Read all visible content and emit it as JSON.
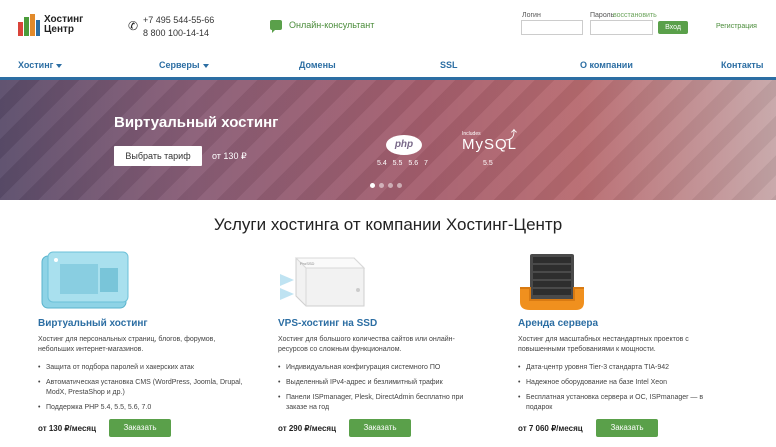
{
  "header": {
    "logo_text_line1": "Хостинг",
    "logo_text_line2": "Центр",
    "phone1": "+7 495 544-55-66",
    "phone2": "8 800 100-14-14",
    "consult_label": "Онлайн-консультант",
    "login_label": "Логин",
    "password_label": "Пароль",
    "forgot_label": "восстановить",
    "login_button": "Вход",
    "register_link": "Регистрация"
  },
  "nav": {
    "items": [
      {
        "label": "Хостинг"
      },
      {
        "label": "Серверы"
      },
      {
        "label": "Домены"
      },
      {
        "label": "SSL"
      },
      {
        "label": "О компании"
      },
      {
        "label": "Контакты"
      }
    ]
  },
  "banner": {
    "title": "Виртуальный хостинг",
    "button": "Выбрать тариф",
    "price": "от 130 ₽",
    "php_logo": "php",
    "php_versions": "5.4 5.5 5.6 7",
    "mysql_includes": "Includes",
    "mysql_logo": "MySQL",
    "mysql_version": "5.5",
    "slide_count": 4,
    "active_slide": 1
  },
  "section": {
    "title": "Услуги хостинга от компании Хостинг-Центр"
  },
  "services": [
    {
      "title": "Виртуальный хостинг",
      "desc": "Хостинг для персональных страниц, блогов, форумов, небольших интернет-магазинов.",
      "features": [
        "Защита от подбора паролей и хакерских атак",
        "Автоматическая установка CMS (WordPress, Joomla, Drupal, ModX, PrestaShop и др.)",
        "Поддержка PHP 5.4, 5.5, 5.6, 7.0"
      ],
      "price": "от 130 ₽/месяц",
      "button": "Заказать"
    },
    {
      "title": "VPS-хостинг на SSD",
      "desc": "Хостинг для большого количества сайтов или онлайн-ресурсов со сложным функционалом.",
      "features": [
        "Индивидуальная конфигурация системного ПО",
        "Выделенный IPv4-адрес и безлимитный трафик",
        "Панели ISPmanager, Plesk, DirectAdmin бесплатно при заказе на год"
      ],
      "price": "от 290 ₽/месяц",
      "button": "Заказать"
    },
    {
      "title": "Аренда сервера",
      "desc": "Хостинг для масштабных нестандартных проектов с повышенными требованиями к мощности.",
      "features": [
        "Дата-центр уровня Tier-3 стандарта TIA-942",
        "Надежное оборудование на базе Intel Xeon",
        "Бесплатная установка сервера и ОС, ISPmanager — в подарок"
      ],
      "price": "от 7 060 ₽/месяц",
      "button": "Заказать"
    }
  ],
  "colors": {
    "accent_blue": "#2c6ea3",
    "accent_green": "#5aa04a"
  }
}
